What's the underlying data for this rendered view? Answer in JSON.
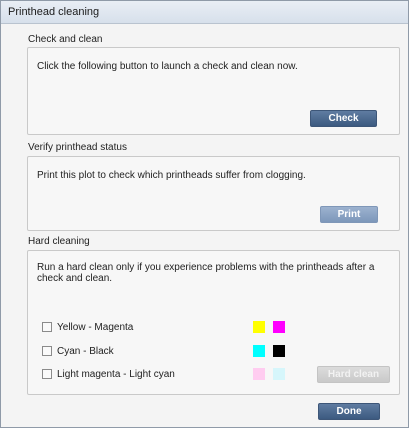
{
  "window": {
    "title": "Printhead cleaning"
  },
  "check_clean": {
    "label": "Check and clean",
    "description": "Click the following button to launch a check and clean now.",
    "button": "Check"
  },
  "verify": {
    "label": "Verify printhead status",
    "description": "Print this plot to check which printheads suffer from clogging.",
    "button": "Print"
  },
  "hard": {
    "label": "Hard cleaning",
    "description": "Run a hard clean only if you experience problems with the printheads after a check and clean.",
    "options": [
      {
        "label": "Yellow - Magenta",
        "checked": false,
        "colors": [
          "#ffff00",
          "#ff00ff"
        ]
      },
      {
        "label": "Cyan - Black",
        "checked": false,
        "colors": [
          "#00ffff",
          "#000000"
        ]
      },
      {
        "label": "Light magenta - Light cyan",
        "checked": false,
        "colors": [
          "#ffccf0",
          "#d6f6fb"
        ]
      }
    ],
    "button": "Hard clean"
  },
  "footer": {
    "done_button": "Done"
  }
}
